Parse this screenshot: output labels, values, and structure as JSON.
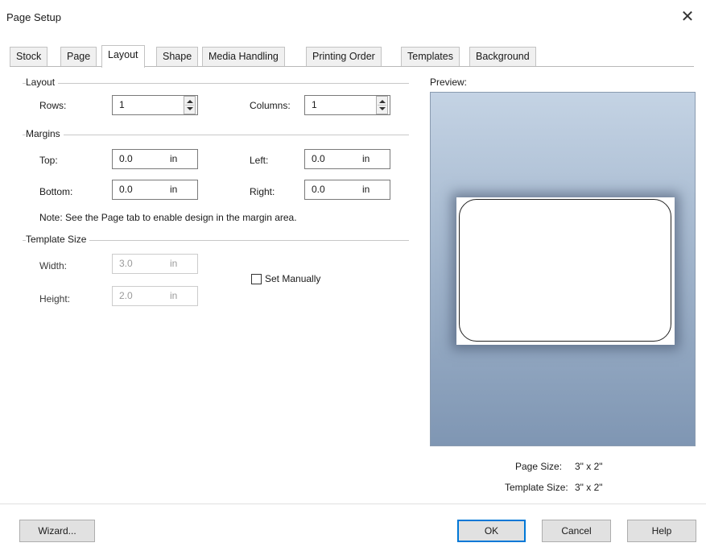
{
  "window": {
    "title": "Page Setup",
    "close_glyph": "✕"
  },
  "tabs": [
    {
      "label": "Stock"
    },
    {
      "label": "Page"
    },
    {
      "label": "Layout",
      "active": true
    },
    {
      "label": "Shape"
    },
    {
      "label": "Media Handling"
    },
    {
      "label": "Printing Order"
    },
    {
      "label": "Templates"
    },
    {
      "label": "Background"
    }
  ],
  "layout_section": {
    "heading": "Layout",
    "rows_label": "Rows:",
    "rows_value": "1",
    "columns_label": "Columns:",
    "columns_value": "1"
  },
  "margins_section": {
    "heading": "Margins",
    "top_label": "Top:",
    "top_value": "0.0",
    "left_label": "Left:",
    "left_value": "0.0",
    "bottom_label": "Bottom:",
    "bottom_value": "0.0",
    "right_label": "Right:",
    "right_value": "0.0",
    "unit": "in",
    "note": "Note: See the Page tab to enable design in the margin area."
  },
  "template_size_section": {
    "heading": "Template Size",
    "width_label": "Width:",
    "width_value": "3.0",
    "height_label": "Height:",
    "height_value": "2.0",
    "unit": "in",
    "set_manually_label": "Set Manually",
    "set_manually_checked": false
  },
  "preview": {
    "heading": "Preview:",
    "page_size_label": "Page Size:",
    "page_size_value": "3\" x 2\"",
    "template_size_label": "Template Size:",
    "template_size_value": "3\" x 2\""
  },
  "buttons": {
    "wizard": "Wizard...",
    "ok": "OK",
    "cancel": "Cancel",
    "help": "Help"
  },
  "colors": {
    "preview_top": "#c4d3e4",
    "preview_bottom": "#7f96b3",
    "default_button_border": "#0078d7"
  }
}
